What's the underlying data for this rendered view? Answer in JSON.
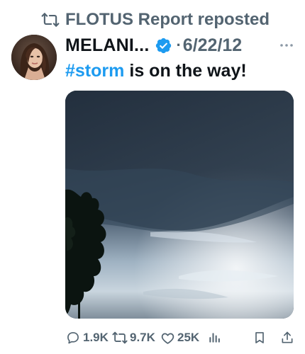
{
  "repost": {
    "text": "FLOTUS Report reposted",
    "icon": "repost-icon"
  },
  "post": {
    "display_name": "MELANI...",
    "verified": true,
    "separator": "·",
    "date": "6/22/12",
    "text_hashtag": "#storm",
    "text_rest": "is on the way!",
    "media": {
      "description_icon": "storm-clouds-photo"
    }
  },
  "actions": {
    "replies": "1.9K",
    "reposts": "9.7K",
    "likes": "25K"
  },
  "colors": {
    "text": "#0f1419",
    "muted": "#536471",
    "accent": "#1d9bf0"
  },
  "icons": [
    "repost-icon",
    "verified-badge-icon",
    "more-icon",
    "reply-icon",
    "like-icon",
    "views-icon",
    "bookmark-icon",
    "share-icon"
  ]
}
